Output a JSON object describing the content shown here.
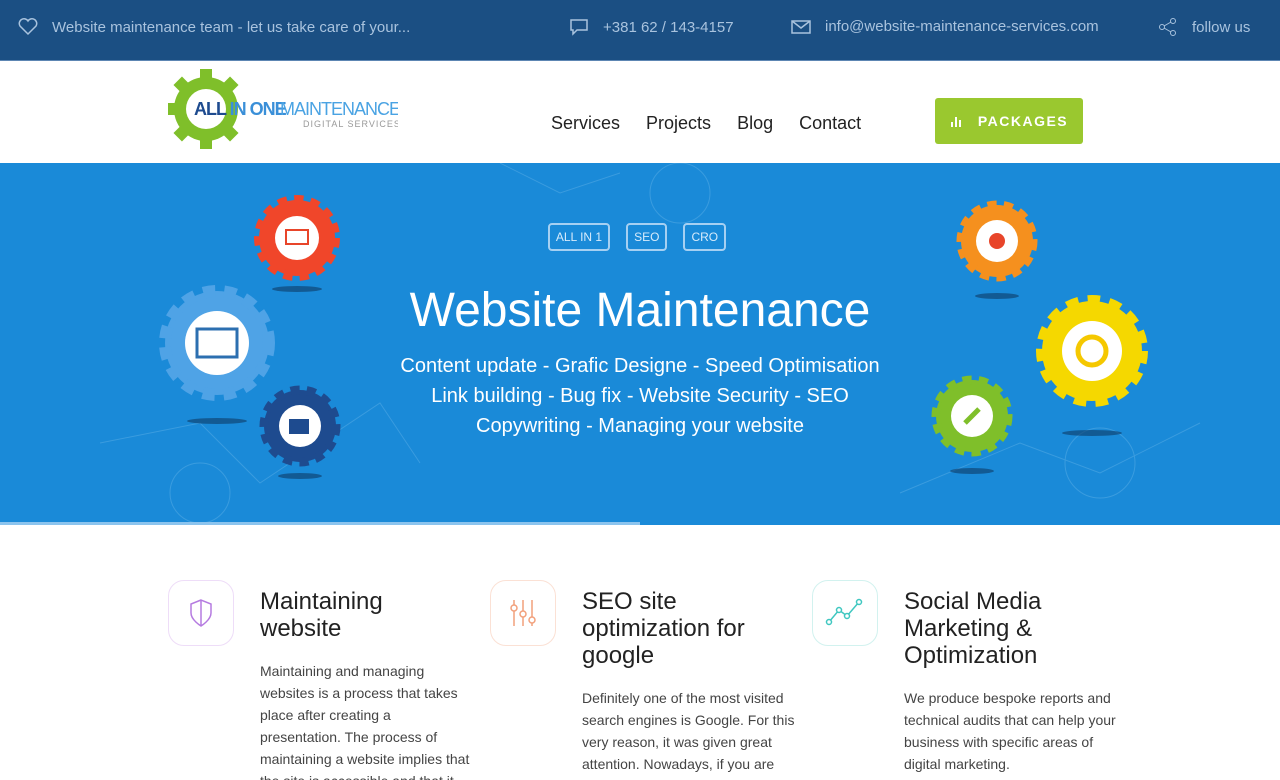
{
  "topbar": {
    "tagline": "Website maintenance team - let us take care of your...",
    "phone": "+381 62 / 143-4157",
    "email": "info@website-maintenance-services.com",
    "follow": "follow us"
  },
  "logo": {
    "text1": "ALL IN ONE",
    "text2": "MAINTENANCE",
    "text3": "DIGITAL SERVICES"
  },
  "nav": [
    {
      "label": "Services"
    },
    {
      "label": "Projects"
    },
    {
      "label": "Blog"
    },
    {
      "label": "Contact"
    }
  ],
  "packages": "PACKAGES",
  "hero": {
    "tags": [
      "ALL IN 1",
      "SEO",
      "CRO"
    ],
    "title": "Website Maintenance",
    "lines": [
      "Content update - Grafic Designe - Speed Optimisation",
      "Link building - Bug fix -  Website Security - SEO",
      "Copywriting - Managing your website"
    ],
    "progress_percent": 50
  },
  "features": [
    {
      "title": "Maintaining website",
      "icon": "shield-icon",
      "color": "#b57be0",
      "text": "Maintaining and managing websites is a process that takes place after creating a presentation. The process of maintaining a website implies that the site is accessible and that it"
    },
    {
      "title": "SEO site optimization for google",
      "icon": "sliders-icon",
      "color": "#f2a07b",
      "text": "Definitely one of the most visited search engines is Google. For this very reason, it was given great attention. Nowadays, if you are"
    },
    {
      "title": "Social Media Marketing & Optimization",
      "icon": "chart-line-icon",
      "color": "#3fc7c0",
      "text": "We produce bespoke reports and technical audits that can help your business with specific areas of digital marketing."
    }
  ],
  "colors": {
    "topbar": "#1b4f83",
    "hero": "#1a8ad8",
    "accent": "#9ac82f"
  }
}
